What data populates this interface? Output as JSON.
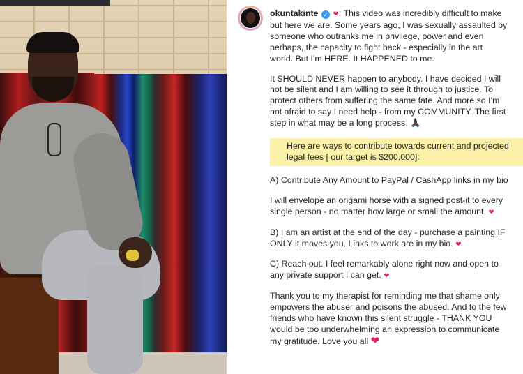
{
  "post": {
    "handle": "okuntakinte",
    "icons": {
      "verified": "verified-badge-icon",
      "heart": "heart-emoji-icon",
      "praying": "praying-hands-emoji-icon"
    },
    "paragraphs": [
      {
        "id": "intro",
        "lines": [
          ": This video was incredibly difficult to make",
          "but here we are. Some years ago, I was sexually assaulted by",
          "someone who outranks me in privilege, power and even",
          "perhaps, the capacity to fight back - especially in the art",
          "world. But I'm HERE. It HAPPENED to me."
        ]
      },
      {
        "id": "never",
        "lines": [
          "It SHOULD NEVER happen to anybody. I have decided I will",
          "not be silent and I am willing to see it through to justice. To",
          "protect others from suffering the same fate. And more so I'm",
          "not afraid to say I need help - from my COMMUNITY. The first",
          "step in what may be a long process. 🙏🏿"
        ]
      },
      {
        "id": "ways",
        "lines": [
          "Here are ways to contribute towards current and projected",
          "legal fees [ our target is $200,000]:"
        ]
      },
      {
        "id": "a",
        "lines": [
          "A) Contribute Any Amount to PayPal / CashApp links in my bio"
        ]
      },
      {
        "id": "envelope",
        "lines": [
          "I will envelope an origami horse with a signed post-it to every",
          "single person - no matter how large or small the amount."
        ]
      },
      {
        "id": "b",
        "lines": [
          "B) I am an artist at the end of the day - purchase a painting IF",
          "ONLY it moves you. Links to work are in my bio."
        ]
      },
      {
        "id": "c",
        "lines": [
          "C) Reach out. I feel remarkably alone right now and open to",
          "any private support I can get."
        ]
      },
      {
        "id": "thanks",
        "lines": [
          "Thank you to my therapist for reminding me that shame only",
          "empowers the abuser and poisons the abused. And to the few",
          "friends who have known this silent struggle - THANK YOU",
          "would be too underwhelming an expression to communicate",
          "my gratitude. Love you all"
        ]
      }
    ],
    "colors": {
      "highlight": "#fbf0a8",
      "verified": "#3897f0",
      "heart": "#e0245e"
    }
  }
}
